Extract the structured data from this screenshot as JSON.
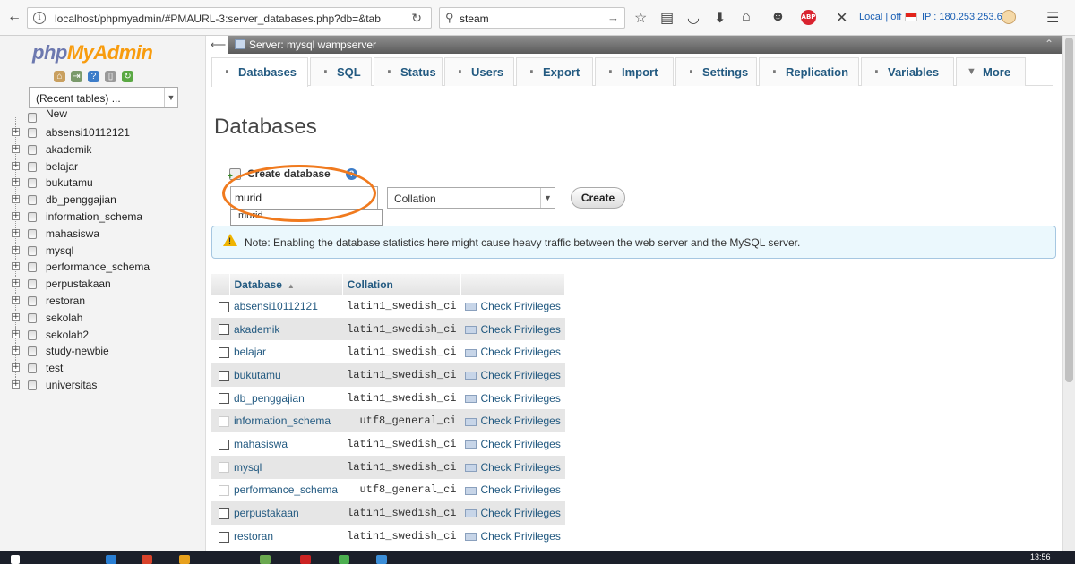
{
  "browser": {
    "url": "localhost/phpmyadmin/#PMAURL-3:server_databases.php?db=&tab",
    "search_text": "steam",
    "ext_status": "Local | off",
    "ext_ip": "IP : 180.253.253.6"
  },
  "sidebar": {
    "logo_php": "php",
    "logo_myadmin": "MyAdmin",
    "recent_tables": "(Recent tables) ...",
    "new_label": "New",
    "databases": [
      "absensi10112121",
      "akademik",
      "belajar",
      "bukutamu",
      "db_penggajian",
      "information_schema",
      "mahasiswa",
      "mysql",
      "performance_schema",
      "perpustakaan",
      "restoran",
      "sekolah",
      "sekolah2",
      "study-newbie",
      "test",
      "universitas"
    ]
  },
  "server_bar": {
    "title": "Server: mysql wampserver"
  },
  "tabs": [
    {
      "label": "Databases",
      "icon": "database-icon",
      "active": true
    },
    {
      "label": "SQL",
      "icon": "sql-icon"
    },
    {
      "label": "Status",
      "icon": "status-icon"
    },
    {
      "label": "Users",
      "icon": "users-icon"
    },
    {
      "label": "Export",
      "icon": "export-icon"
    },
    {
      "label": "Import",
      "icon": "import-icon"
    },
    {
      "label": "Settings",
      "icon": "settings-icon"
    },
    {
      "label": "Replication",
      "icon": "replication-icon"
    },
    {
      "label": "Variables",
      "icon": "variables-icon"
    },
    {
      "label": "More",
      "icon": "chevron-down-icon"
    }
  ],
  "page": {
    "title": "Databases",
    "create_label": "Create database",
    "dbname_value": "murid",
    "autocomplete": "murid",
    "collation_placeholder": "Collation",
    "create_button": "Create",
    "notice": "Note: Enabling the database statistics here might cause heavy traffic between the web server and the MySQL server."
  },
  "table": {
    "headers": {
      "database": "Database",
      "collation": "Collation"
    },
    "rows": [
      {
        "name": "absensi10112121",
        "collation": "latin1_swedish_ci",
        "action": "Check Privileges",
        "disabled": false
      },
      {
        "name": "akademik",
        "collation": "latin1_swedish_ci",
        "action": "Check Privileges",
        "disabled": false
      },
      {
        "name": "belajar",
        "collation": "latin1_swedish_ci",
        "action": "Check Privileges",
        "disabled": false
      },
      {
        "name": "bukutamu",
        "collation": "latin1_swedish_ci",
        "action": "Check Privileges",
        "disabled": false
      },
      {
        "name": "db_penggajian",
        "collation": "latin1_swedish_ci",
        "action": "Check Privileges",
        "disabled": false
      },
      {
        "name": "information_schema",
        "collation": "utf8_general_ci",
        "action": "Check Privileges",
        "disabled": true
      },
      {
        "name": "mahasiswa",
        "collation": "latin1_swedish_ci",
        "action": "Check Privileges",
        "disabled": false
      },
      {
        "name": "mysql",
        "collation": "latin1_swedish_ci",
        "action": "Check Privileges",
        "disabled": true
      },
      {
        "name": "performance_schema",
        "collation": "utf8_general_ci",
        "action": "Check Privileges",
        "disabled": true
      },
      {
        "name": "perpustakaan",
        "collation": "latin1_swedish_ci",
        "action": "Check Privileges",
        "disabled": false
      },
      {
        "name": "restoran",
        "collation": "latin1_swedish_ci",
        "action": "Check Privileges",
        "disabled": false
      }
    ]
  },
  "taskbar": {
    "time": "13:56"
  },
  "colors": {
    "accent": "#235a81",
    "highlight": "#f07a1e",
    "logo_orange": "#f89c0e",
    "logo_blue": "#6c78af"
  }
}
